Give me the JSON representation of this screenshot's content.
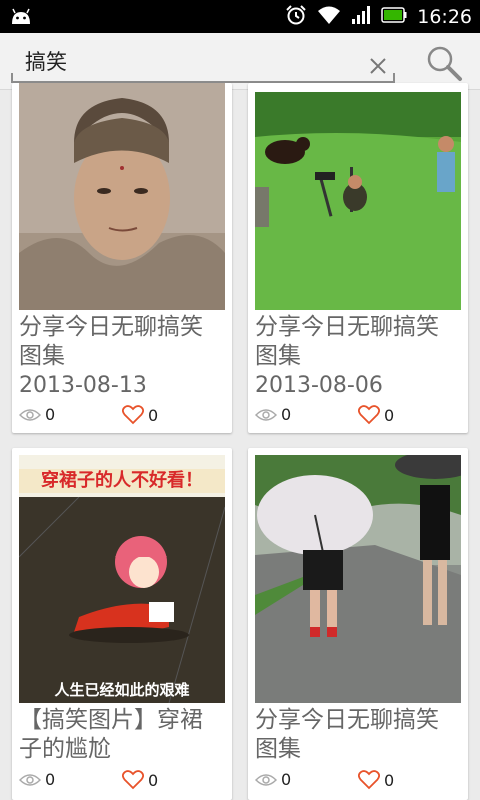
{
  "status_bar": {
    "time": "16:26",
    "icons": [
      "android-icon",
      "alarm-icon",
      "wifi-icon",
      "signal-icon",
      "battery-icon"
    ]
  },
  "search": {
    "value": "搞笑",
    "clear_icon": "close-icon",
    "search_icon": "search-icon"
  },
  "cards": [
    {
      "title": "分享今日无聊搞笑图集",
      "date": "2013-08-13",
      "views": "0",
      "likes": "0"
    },
    {
      "title": "分享今日无聊搞笑图集",
      "date": "2013-08-06",
      "views": "0",
      "likes": "0"
    },
    {
      "title": "【搞笑图片】穿裙子的尴尬",
      "image_text_top": "穿裙子的人不好看！",
      "image_text_bottom": "人生已经如此的艰难",
      "views": "0",
      "likes": "0"
    },
    {
      "title": "分享今日无聊搞笑图集",
      "views": "0",
      "likes": "0"
    }
  ],
  "colors": {
    "accent_heart": "#e8532b",
    "battery": "#34b600"
  }
}
